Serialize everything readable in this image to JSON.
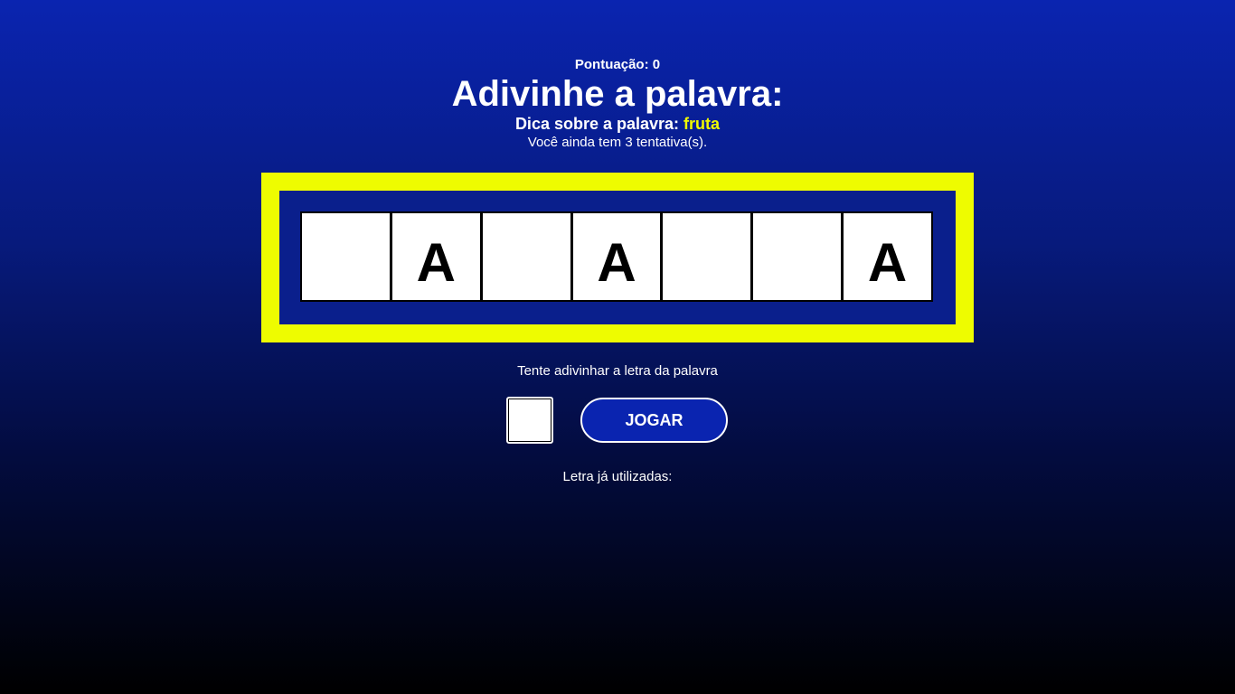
{
  "score": {
    "label": "Pontuação:",
    "value": "0"
  },
  "title": "Adivinhe a palavra:",
  "hint": {
    "label": "Dica sobre a palavra:",
    "value": "fruta"
  },
  "attempts": {
    "prefix": "Você ainda tem",
    "count": "3",
    "suffix": "tentativa(s)."
  },
  "word_tiles": [
    "",
    "A",
    "",
    "A",
    "",
    "",
    "A"
  ],
  "instruction": "Tente adivinhar a letra da palavra",
  "letter_input": {
    "value": "",
    "placeholder": ""
  },
  "play_button": "JOGAR",
  "used_letters": {
    "label": "Letra já utilizadas:",
    "letters": ""
  },
  "colors": {
    "background_top": "#0a24b0",
    "background_bottom": "#000000",
    "frame": "#eefc00",
    "hint_value": "#f0fa00",
    "button": "#0a24b0"
  }
}
